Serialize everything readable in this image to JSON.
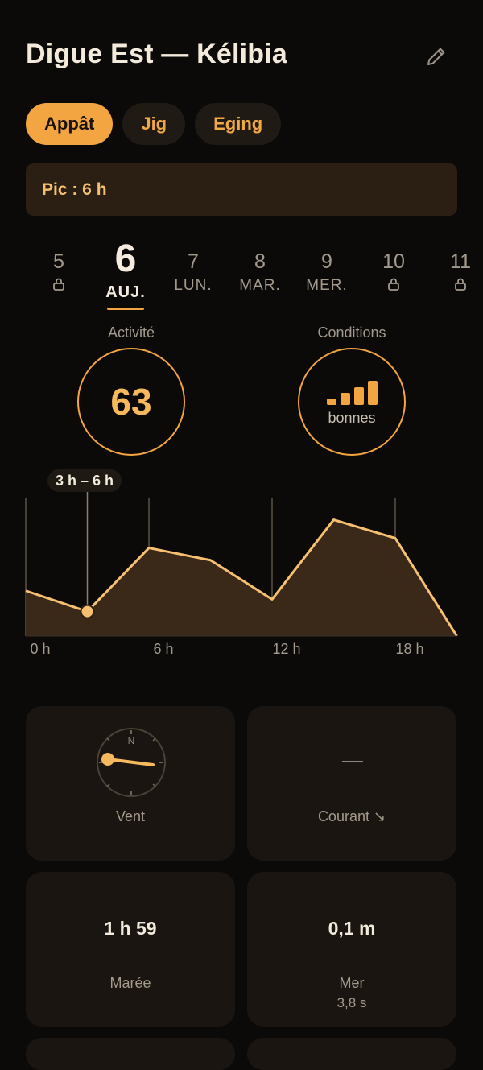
{
  "header": {
    "title": "Digue Est — Kélibia",
    "edit_icon": "pencil-icon"
  },
  "tabs": [
    {
      "label": "Appât",
      "active": true
    },
    {
      "label": "Jig",
      "active": false
    },
    {
      "label": "Eging",
      "active": false
    }
  ],
  "peak": {
    "label": "Pic : 6 h"
  },
  "days": [
    {
      "num": "5",
      "sub": "",
      "locked": true
    },
    {
      "num": "6",
      "sub": "AUJ.",
      "selected": true
    },
    {
      "num": "7",
      "sub": "LUN."
    },
    {
      "num": "8",
      "sub": "MAR."
    },
    {
      "num": "9",
      "sub": "MER."
    },
    {
      "num": "10",
      "sub": "",
      "locked": true
    },
    {
      "num": "11",
      "sub": "",
      "locked": true
    }
  ],
  "activity": {
    "label": "Activité",
    "score": "63"
  },
  "conditions": {
    "label": "Conditions",
    "value": "bonnes",
    "level": 4
  },
  "chart_data": {
    "type": "area",
    "selection_label": "3 h – 6 h",
    "x_ticks": [
      "0 h",
      "6 h",
      "12 h",
      "18 h"
    ],
    "x": [
      0,
      3,
      6,
      9,
      12,
      15,
      18,
      21
    ],
    "values": [
      37,
      20,
      72,
      62,
      30,
      95,
      80,
      0
    ],
    "selected_x": 3,
    "ylim": [
      0,
      100
    ],
    "colors": {
      "line": "#f6c070",
      "fill": "#3a2818",
      "grid": "#5a5247"
    }
  },
  "cards": {
    "wind": {
      "label": "Vent",
      "icon": "compass-icon"
    },
    "current": {
      "label": "Courant ↘",
      "value": "—"
    },
    "tide": {
      "label": "Marée",
      "value": "1 h 59"
    },
    "sea": {
      "label": "Mer",
      "value": "0,1 m",
      "period": "3,8 s"
    }
  }
}
